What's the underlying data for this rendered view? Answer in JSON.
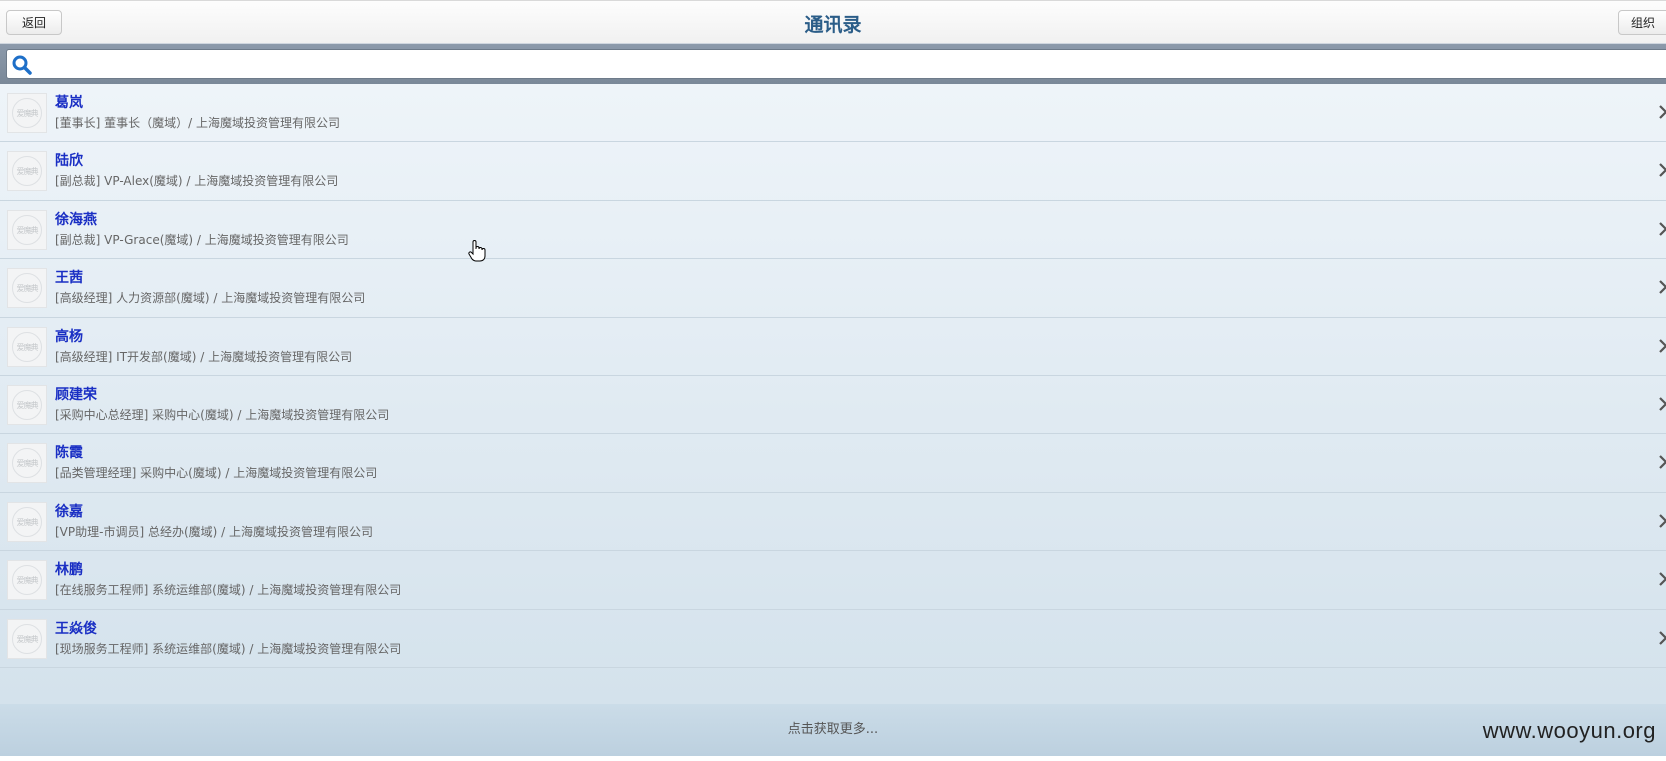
{
  "header": {
    "back_label": "返回",
    "title": "通讯录",
    "org_label": "组织"
  },
  "search": {
    "value": "",
    "placeholder": ""
  },
  "avatar_text": "爱魔典",
  "contacts": [
    {
      "name": "葛岚",
      "desc": "[董事长] 董事长（魔域）/ 上海魔域投资管理有限公司"
    },
    {
      "name": "陆欣",
      "desc": "[副总裁] VP-Alex(魔域) / 上海魔域投资管理有限公司"
    },
    {
      "name": "徐海燕",
      "desc": "[副总裁] VP-Grace(魔域) / 上海魔域投资管理有限公司"
    },
    {
      "name": "王茜",
      "desc": "[高级经理] 人力资源部(魔域) / 上海魔域投资管理有限公司"
    },
    {
      "name": "高杨",
      "desc": "[高级经理] IT开发部(魔域) / 上海魔域投资管理有限公司"
    },
    {
      "name": "顾建荣",
      "desc": "[采购中心总经理] 采购中心(魔域) / 上海魔域投资管理有限公司"
    },
    {
      "name": "陈霞",
      "desc": "[品类管理经理] 采购中心(魔域) / 上海魔域投资管理有限公司"
    },
    {
      "name": "徐嘉",
      "desc": "[VP助理-市调员] 总经办(魔域) / 上海魔域投资管理有限公司"
    },
    {
      "name": "林鹏",
      "desc": "[在线服务工程师] 系统运维部(魔域) / 上海魔域投资管理有限公司"
    },
    {
      "name": "王焱俊",
      "desc": "[现场服务工程师] 系统运维部(魔域) / 上海魔域投资管理有限公司"
    }
  ],
  "more_label": "点击获取更多...",
  "watermark": "www.wooyun.org",
  "colors": {
    "title": "#2b5d88",
    "name": "#1a2fc4",
    "search_bar": "#8c9aab"
  }
}
